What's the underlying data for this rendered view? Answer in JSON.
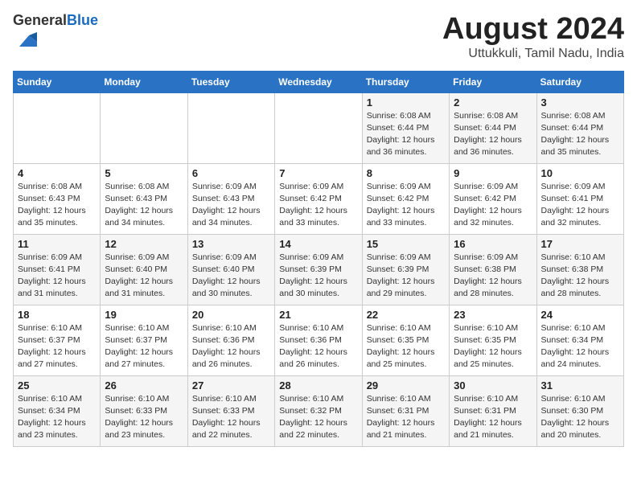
{
  "logo": {
    "general": "General",
    "blue": "Blue"
  },
  "calendar": {
    "title": "August 2024",
    "subtitle": "Uttukkuli, Tamil Nadu, India"
  },
  "headers": [
    "Sunday",
    "Monday",
    "Tuesday",
    "Wednesday",
    "Thursday",
    "Friday",
    "Saturday"
  ],
  "weeks": [
    [
      {
        "day": "",
        "info": ""
      },
      {
        "day": "",
        "info": ""
      },
      {
        "day": "",
        "info": ""
      },
      {
        "day": "",
        "info": ""
      },
      {
        "day": "1",
        "info": "Sunrise: 6:08 AM\nSunset: 6:44 PM\nDaylight: 12 hours\nand 36 minutes."
      },
      {
        "day": "2",
        "info": "Sunrise: 6:08 AM\nSunset: 6:44 PM\nDaylight: 12 hours\nand 36 minutes."
      },
      {
        "day": "3",
        "info": "Sunrise: 6:08 AM\nSunset: 6:44 PM\nDaylight: 12 hours\nand 35 minutes."
      }
    ],
    [
      {
        "day": "4",
        "info": "Sunrise: 6:08 AM\nSunset: 6:43 PM\nDaylight: 12 hours\nand 35 minutes."
      },
      {
        "day": "5",
        "info": "Sunrise: 6:08 AM\nSunset: 6:43 PM\nDaylight: 12 hours\nand 34 minutes."
      },
      {
        "day": "6",
        "info": "Sunrise: 6:09 AM\nSunset: 6:43 PM\nDaylight: 12 hours\nand 34 minutes."
      },
      {
        "day": "7",
        "info": "Sunrise: 6:09 AM\nSunset: 6:42 PM\nDaylight: 12 hours\nand 33 minutes."
      },
      {
        "day": "8",
        "info": "Sunrise: 6:09 AM\nSunset: 6:42 PM\nDaylight: 12 hours\nand 33 minutes."
      },
      {
        "day": "9",
        "info": "Sunrise: 6:09 AM\nSunset: 6:42 PM\nDaylight: 12 hours\nand 32 minutes."
      },
      {
        "day": "10",
        "info": "Sunrise: 6:09 AM\nSunset: 6:41 PM\nDaylight: 12 hours\nand 32 minutes."
      }
    ],
    [
      {
        "day": "11",
        "info": "Sunrise: 6:09 AM\nSunset: 6:41 PM\nDaylight: 12 hours\nand 31 minutes."
      },
      {
        "day": "12",
        "info": "Sunrise: 6:09 AM\nSunset: 6:40 PM\nDaylight: 12 hours\nand 31 minutes."
      },
      {
        "day": "13",
        "info": "Sunrise: 6:09 AM\nSunset: 6:40 PM\nDaylight: 12 hours\nand 30 minutes."
      },
      {
        "day": "14",
        "info": "Sunrise: 6:09 AM\nSunset: 6:39 PM\nDaylight: 12 hours\nand 30 minutes."
      },
      {
        "day": "15",
        "info": "Sunrise: 6:09 AM\nSunset: 6:39 PM\nDaylight: 12 hours\nand 29 minutes."
      },
      {
        "day": "16",
        "info": "Sunrise: 6:09 AM\nSunset: 6:38 PM\nDaylight: 12 hours\nand 28 minutes."
      },
      {
        "day": "17",
        "info": "Sunrise: 6:10 AM\nSunset: 6:38 PM\nDaylight: 12 hours\nand 28 minutes."
      }
    ],
    [
      {
        "day": "18",
        "info": "Sunrise: 6:10 AM\nSunset: 6:37 PM\nDaylight: 12 hours\nand 27 minutes."
      },
      {
        "day": "19",
        "info": "Sunrise: 6:10 AM\nSunset: 6:37 PM\nDaylight: 12 hours\nand 27 minutes."
      },
      {
        "day": "20",
        "info": "Sunrise: 6:10 AM\nSunset: 6:36 PM\nDaylight: 12 hours\nand 26 minutes."
      },
      {
        "day": "21",
        "info": "Sunrise: 6:10 AM\nSunset: 6:36 PM\nDaylight: 12 hours\nand 26 minutes."
      },
      {
        "day": "22",
        "info": "Sunrise: 6:10 AM\nSunset: 6:35 PM\nDaylight: 12 hours\nand 25 minutes."
      },
      {
        "day": "23",
        "info": "Sunrise: 6:10 AM\nSunset: 6:35 PM\nDaylight: 12 hours\nand 25 minutes."
      },
      {
        "day": "24",
        "info": "Sunrise: 6:10 AM\nSunset: 6:34 PM\nDaylight: 12 hours\nand 24 minutes."
      }
    ],
    [
      {
        "day": "25",
        "info": "Sunrise: 6:10 AM\nSunset: 6:34 PM\nDaylight: 12 hours\nand 23 minutes."
      },
      {
        "day": "26",
        "info": "Sunrise: 6:10 AM\nSunset: 6:33 PM\nDaylight: 12 hours\nand 23 minutes."
      },
      {
        "day": "27",
        "info": "Sunrise: 6:10 AM\nSunset: 6:33 PM\nDaylight: 12 hours\nand 22 minutes."
      },
      {
        "day": "28",
        "info": "Sunrise: 6:10 AM\nSunset: 6:32 PM\nDaylight: 12 hours\nand 22 minutes."
      },
      {
        "day": "29",
        "info": "Sunrise: 6:10 AM\nSunset: 6:31 PM\nDaylight: 12 hours\nand 21 minutes."
      },
      {
        "day": "30",
        "info": "Sunrise: 6:10 AM\nSunset: 6:31 PM\nDaylight: 12 hours\nand 21 minutes."
      },
      {
        "day": "31",
        "info": "Sunrise: 6:10 AM\nSunset: 6:30 PM\nDaylight: 12 hours\nand 20 minutes."
      }
    ]
  ]
}
